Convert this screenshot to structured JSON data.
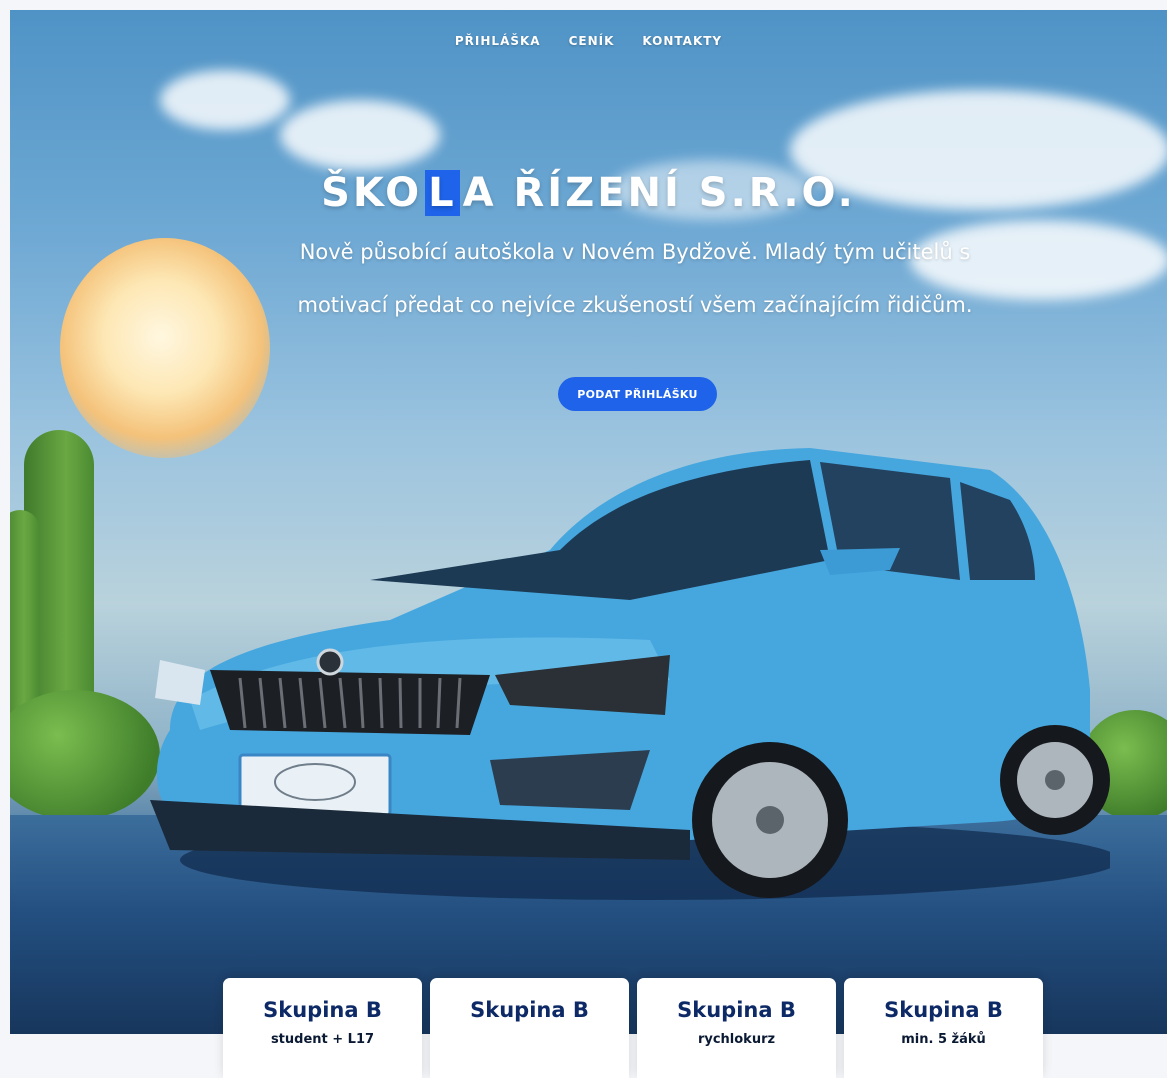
{
  "nav": {
    "items": [
      {
        "label": "PŘIHLÁŠKA"
      },
      {
        "label": "CENÍK"
      },
      {
        "label": "KONTAKTY"
      }
    ]
  },
  "hero": {
    "title_before": "ŠKO",
    "title_highlight": "L",
    "title_after": "A ŘÍZENÍ S.R.O.",
    "lead": "Nově působící autoškola v Novém Bydžově. Mladý tým učitelů s motivací předat co nejvíce zkušeností všem začínajícím řidičům.",
    "cta_label": "PODAT PŘIHLÁŠKU"
  },
  "colors": {
    "accent": "#1e63e9",
    "card_title": "#0d2a66",
    "car_body": "#46a7df"
  },
  "cards": [
    {
      "title": "Skupina B",
      "subtitle": "student + L17"
    },
    {
      "title": "Skupina B",
      "subtitle": ""
    },
    {
      "title": "Skupina B",
      "subtitle": "rychlokurz"
    },
    {
      "title": "Skupina B",
      "subtitle": "min. 5 žáků"
    }
  ]
}
